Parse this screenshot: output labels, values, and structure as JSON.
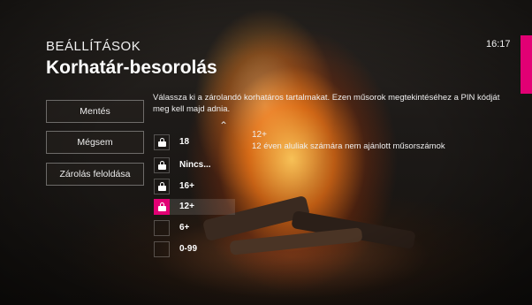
{
  "header": {
    "section": "BEÁLLÍTÁSOK",
    "title": "Korhatár-besorolás",
    "clock": "16:17"
  },
  "buttons": {
    "save": "Mentés",
    "cancel": "Mégsem",
    "unlock": "Zárolás feloldása"
  },
  "description": "Válassza ki a zárolandó korhatáros tartalmakat. Ezen műsorok megtekintéséhez a PIN kódját meg kell majd adnia.",
  "ratings": [
    {
      "label": "18",
      "locked": true
    },
    {
      "label": "Nincs...",
      "locked": true
    },
    {
      "label": "16+",
      "locked": true
    },
    {
      "label": "12+",
      "locked": true,
      "selected": true
    },
    {
      "label": "6+",
      "locked": false
    },
    {
      "label": "0-99",
      "locked": false
    }
  ],
  "info": {
    "rating": "12+",
    "text": "12 éven aluliak számára nem ajánlott műsorszámok"
  },
  "colors": {
    "accent": "#e20074"
  }
}
